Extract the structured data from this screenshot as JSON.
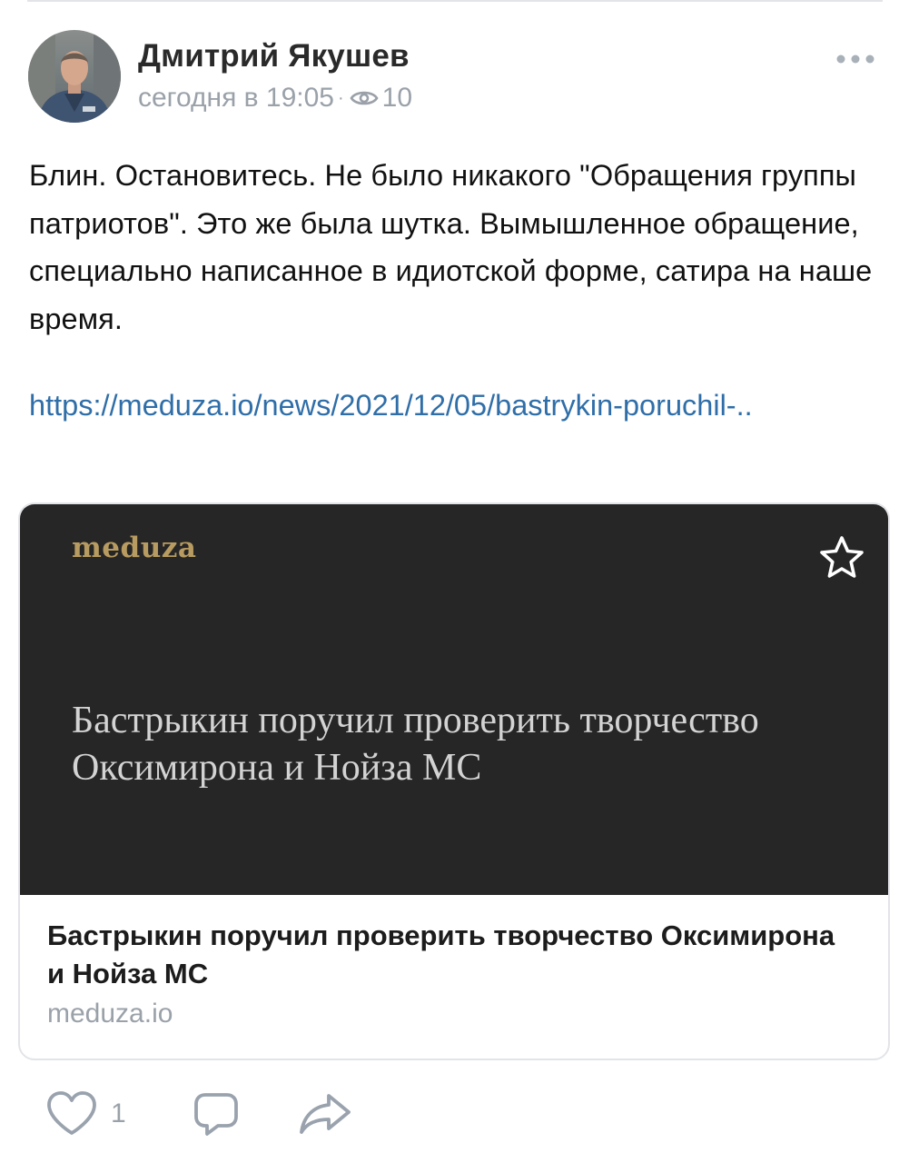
{
  "post": {
    "author": "Дмитрий Якушев",
    "time": "сегодня в 19:05",
    "views": "10",
    "text": "Блин. Остановитесь. Не было никакого \"Обращения группы патриотов\". Это же была шутка. Вымышленное обращение, специально написанное в идиотской форме, сатира на наше время.",
    "link": "https://meduza.io/news/2021/12/05/bastrykin-poruchil-.."
  },
  "card": {
    "logo": "meduza",
    "image_headline": "Бастрыкин поручил проверить творчество Оксимирона и Нойза МС",
    "title": "Бастрыкин поручил проверить творчество Оксимирона и Нойза МС",
    "domain": "meduza.io"
  },
  "actions": {
    "likes": "1"
  },
  "colors": {
    "link": "#2f6ea8",
    "meta": "#9aa1a9",
    "card_image_bg": "#262626",
    "logo": "#b79b60",
    "icon": "#99a2ad"
  },
  "icons": [
    "more-icon",
    "eye-icon",
    "star-icon",
    "heart-icon",
    "comment-icon",
    "share-icon"
  ]
}
